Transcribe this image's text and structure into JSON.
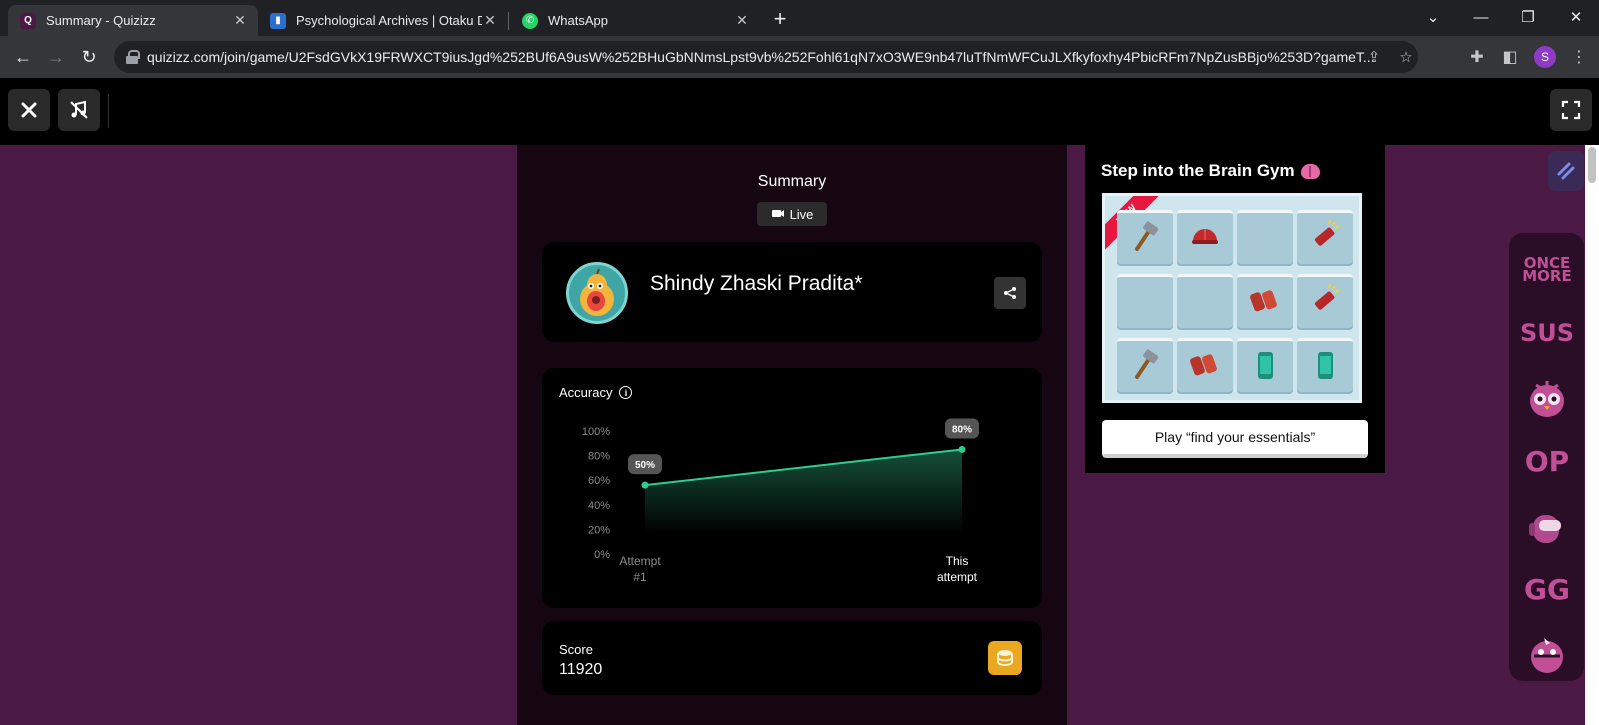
{
  "browser": {
    "tabs": [
      {
        "title": "Summary - Quizizz",
        "favicon": "quizizz-icon",
        "active": true
      },
      {
        "title": "Psychological Archives | Otaku D",
        "favicon": "book-icon",
        "active": false
      },
      {
        "title": "WhatsApp",
        "favicon": "whatsapp-icon",
        "active": false
      }
    ],
    "url": "quizizz.com/join/game/U2FsdGVkX19FRWXCT9iusJgd%252BUf6A9usW%252BHuGbNNmsLpst9vb%252Fohl61qN7xO3WE9nb47luTfNmWFCuJLXfkyfoxhy4PbicRFm7NpZusBBjo%253D?gameT...",
    "profile_initial": "S"
  },
  "summary": {
    "title": "Summary",
    "mode_label": "Live"
  },
  "player": {
    "name": "Shindy Zhaski Pradita*"
  },
  "accuracy": {
    "label": "Accuracy"
  },
  "chart_data": {
    "type": "area",
    "title": "Accuracy",
    "categories": [
      "Attempt #1",
      "This attempt"
    ],
    "category_lines": [
      [
        "Attempt",
        "#1"
      ],
      [
        "This",
        "attempt"
      ]
    ],
    "values": [
      56,
      85
    ],
    "data_labels": [
      "50%",
      "80%"
    ],
    "ylim": [
      0,
      100
    ],
    "yticks": [
      0,
      20,
      40,
      60,
      80,
      100
    ],
    "ytick_labels": [
      "0%",
      "20%",
      "40%",
      "60%",
      "80%",
      "100%"
    ],
    "colors": {
      "line": "#2ecc8f",
      "fill": "#1c6b4e",
      "tick": "#8a8a8a",
      "badge": "#555555"
    }
  },
  "score": {
    "label": "Score",
    "value": "11920"
  },
  "brain_gym": {
    "title": "Step into the Brain Gym",
    "badge": "NEW",
    "play_label": "Play “find your essentials”",
    "tiles": [
      "hammer-icon",
      "helmet-icon",
      "empty",
      "flashlight-icon",
      "empty",
      "empty",
      "binoculars-icon",
      "flashlight-icon",
      "hammer-icon",
      "binoculars-icon",
      "phone-icon",
      "phone-icon"
    ]
  },
  "stickers": [
    {
      "name": "once-more-sticker",
      "text": "ONCE MORE"
    },
    {
      "name": "sus-sticker",
      "text": "SUS"
    },
    {
      "name": "owl-sticker",
      "text": ""
    },
    {
      "name": "op-sticker",
      "text": "OP"
    },
    {
      "name": "astronaut-sticker",
      "text": ""
    },
    {
      "name": "gg-sticker",
      "text": "GG"
    },
    {
      "name": "bird-sticker",
      "text": ""
    }
  ]
}
